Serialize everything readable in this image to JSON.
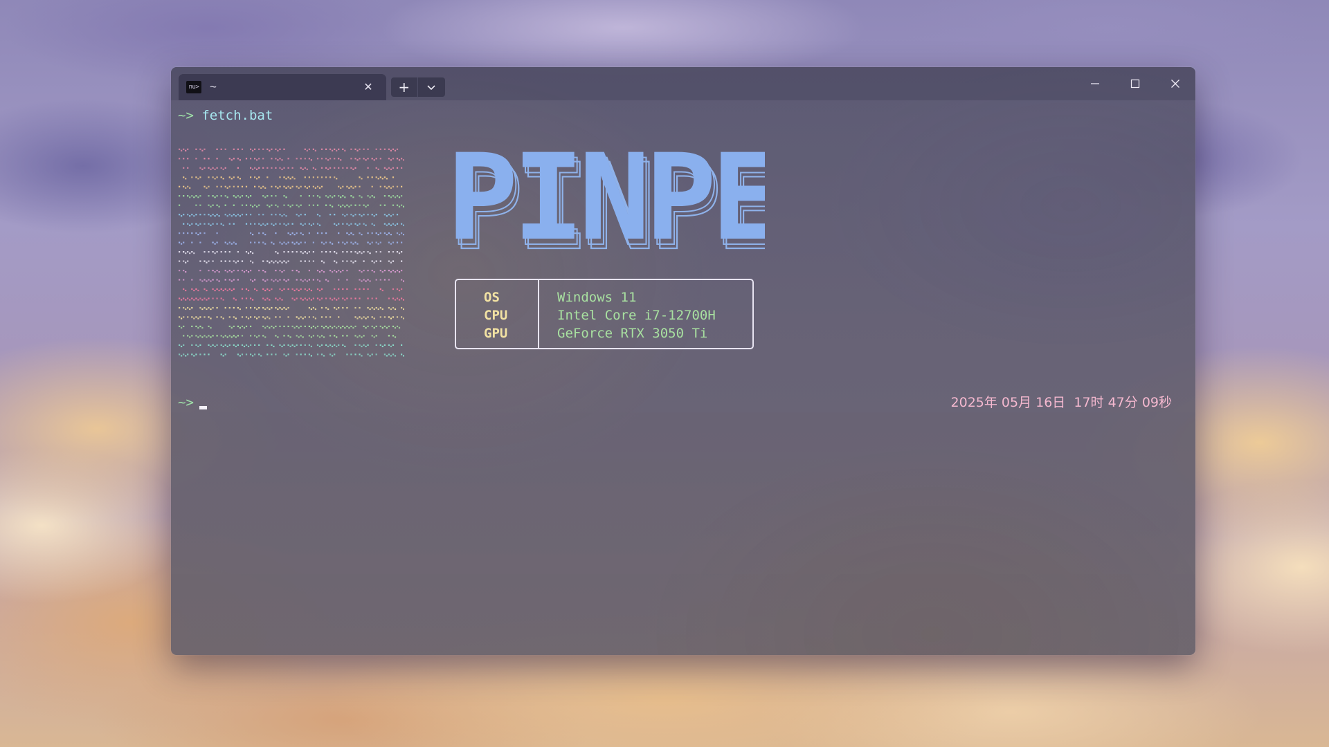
{
  "tab": {
    "icon_text": "nu>",
    "title": "~",
    "close_glyph": "✕"
  },
  "toolbar": {
    "new_tab_glyph": "+",
    "dropdown_glyph": "⌄"
  },
  "terminal": {
    "prompt_symbol": "~>",
    "command": "fetch.bat",
    "logo_text": "PINPE",
    "system_info": [
      {
        "key": "OS",
        "value": "Windows 11"
      },
      {
        "key": "CPU",
        "value": "Intel Core i7-12700H"
      },
      {
        "key": "GPU",
        "value": "GeForce RTX 3050 Ti"
      }
    ],
    "datetime": "2025年 05月 16日  17时 47分 09秒"
  },
  "colors": {
    "prompt": "#9fe0a8",
    "command": "#a7e8f0",
    "logo_fill": "#8ab0ee",
    "logo_outline": "#8fb2ea",
    "info_key": "#f2e2a3",
    "info_value": "#a8e0a0",
    "datetime": "#f4b8cf",
    "ascii_art_rows": [
      "#e58aa8",
      "#f0c98a",
      "#9fe0a0",
      "#8cc8e8",
      "#9fb6f0",
      "#e8e4f2",
      "#d89ad0",
      "#f07aa0",
      "#f2e0a0",
      "#a8e0a0",
      "#8ad8c8"
    ]
  }
}
